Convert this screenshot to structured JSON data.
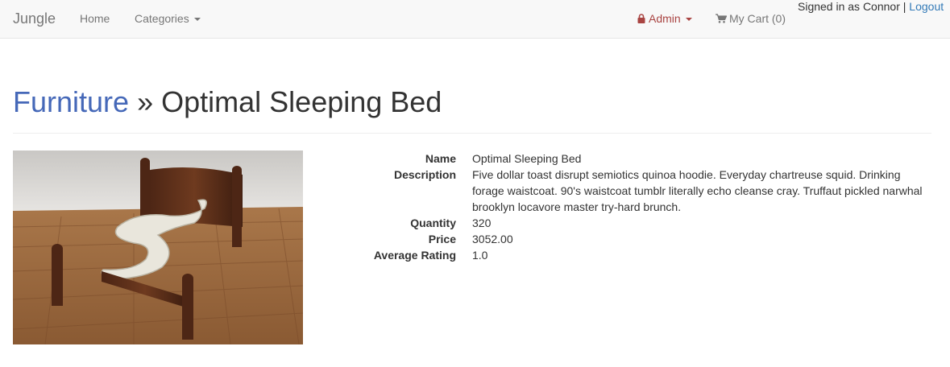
{
  "navbar": {
    "brand": "Jungle",
    "home": "Home",
    "categories": "Categories",
    "admin": "Admin",
    "cart": "My Cart (0)",
    "signed_in": "Signed in as Connor",
    "separator": "|",
    "logout": "Logout"
  },
  "header": {
    "category": "Furniture",
    "separator": "»",
    "product_name": "Optimal Sleeping Bed"
  },
  "product": {
    "fields": [
      {
        "label": "Name",
        "value": "Optimal Sleeping Bed"
      },
      {
        "label": "Description",
        "value": "Five dollar toast disrupt semiotics quinoa hoodie. Everyday chartreuse squid. Drinking forage waistcoat. 90's waistcoat tumblr literally echo cleanse cray. Truffaut pickled narwhal brooklyn locavore master try-hard brunch."
      },
      {
        "label": "Quantity",
        "value": "320"
      },
      {
        "label": "Price",
        "value": "3052.00"
      },
      {
        "label": "Average Rating",
        "value": "1.0"
      }
    ]
  },
  "colors": {
    "navbar_bg": "#f8f8f8",
    "link": "#337ab7",
    "category_link": "#4568b8",
    "admin": "#a94442",
    "muted": "#777777",
    "text": "#333333"
  },
  "icons": {
    "admin": "lock-icon",
    "cart": "shopping-cart-icon",
    "dropdown": "caret-down-icon"
  }
}
